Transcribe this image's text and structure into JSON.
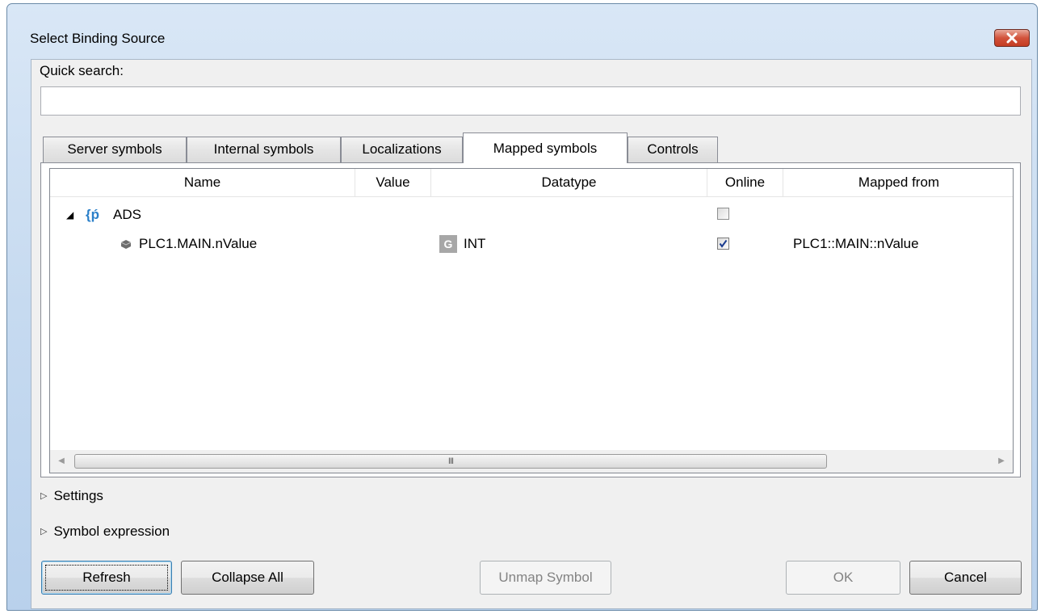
{
  "window": {
    "title": "Select Binding Source"
  },
  "search": {
    "label": "Quick search:",
    "value": "",
    "placeholder": ""
  },
  "tabs": [
    {
      "label": "Server symbols",
      "active": false
    },
    {
      "label": "Internal symbols",
      "active": false
    },
    {
      "label": "Localizations",
      "active": false
    },
    {
      "label": "Mapped symbols",
      "active": true
    },
    {
      "label": "Controls",
      "active": false
    }
  ],
  "grid": {
    "columns": [
      "Name",
      "Value",
      "Datatype",
      "Online",
      "Mapped from"
    ],
    "rows": [
      {
        "expand": "◢",
        "icon": "{ṕ",
        "name": "ADS",
        "value": "",
        "datatype_badge": "",
        "datatype": "",
        "online": false,
        "mapped_from": ""
      },
      {
        "expand": "",
        "icon": "",
        "name": "PLC1.MAIN.nValue",
        "value": "",
        "datatype_badge": "G",
        "datatype": "INT",
        "online": true,
        "mapped_from": "PLC1::MAIN::nValue"
      }
    ],
    "scroll_grip": "III"
  },
  "expanders": {
    "settings": "Settings",
    "symbol_expression": "Symbol expression"
  },
  "buttons": {
    "refresh": "Refresh",
    "collapse_all": "Collapse All",
    "unmap_symbol": "Unmap Symbol",
    "ok": "OK",
    "cancel": "Cancel"
  },
  "colors": {
    "frame": "#c6daf0",
    "close": "#c43c22",
    "check": "#1a3c8f"
  },
  "icons": [
    "close-icon",
    "expand-triangle-icon",
    "namespace-icon",
    "symbol-icon",
    "datatype-badge-icon",
    "checkbox-icon",
    "scroll-left-icon",
    "scroll-right-icon"
  ]
}
